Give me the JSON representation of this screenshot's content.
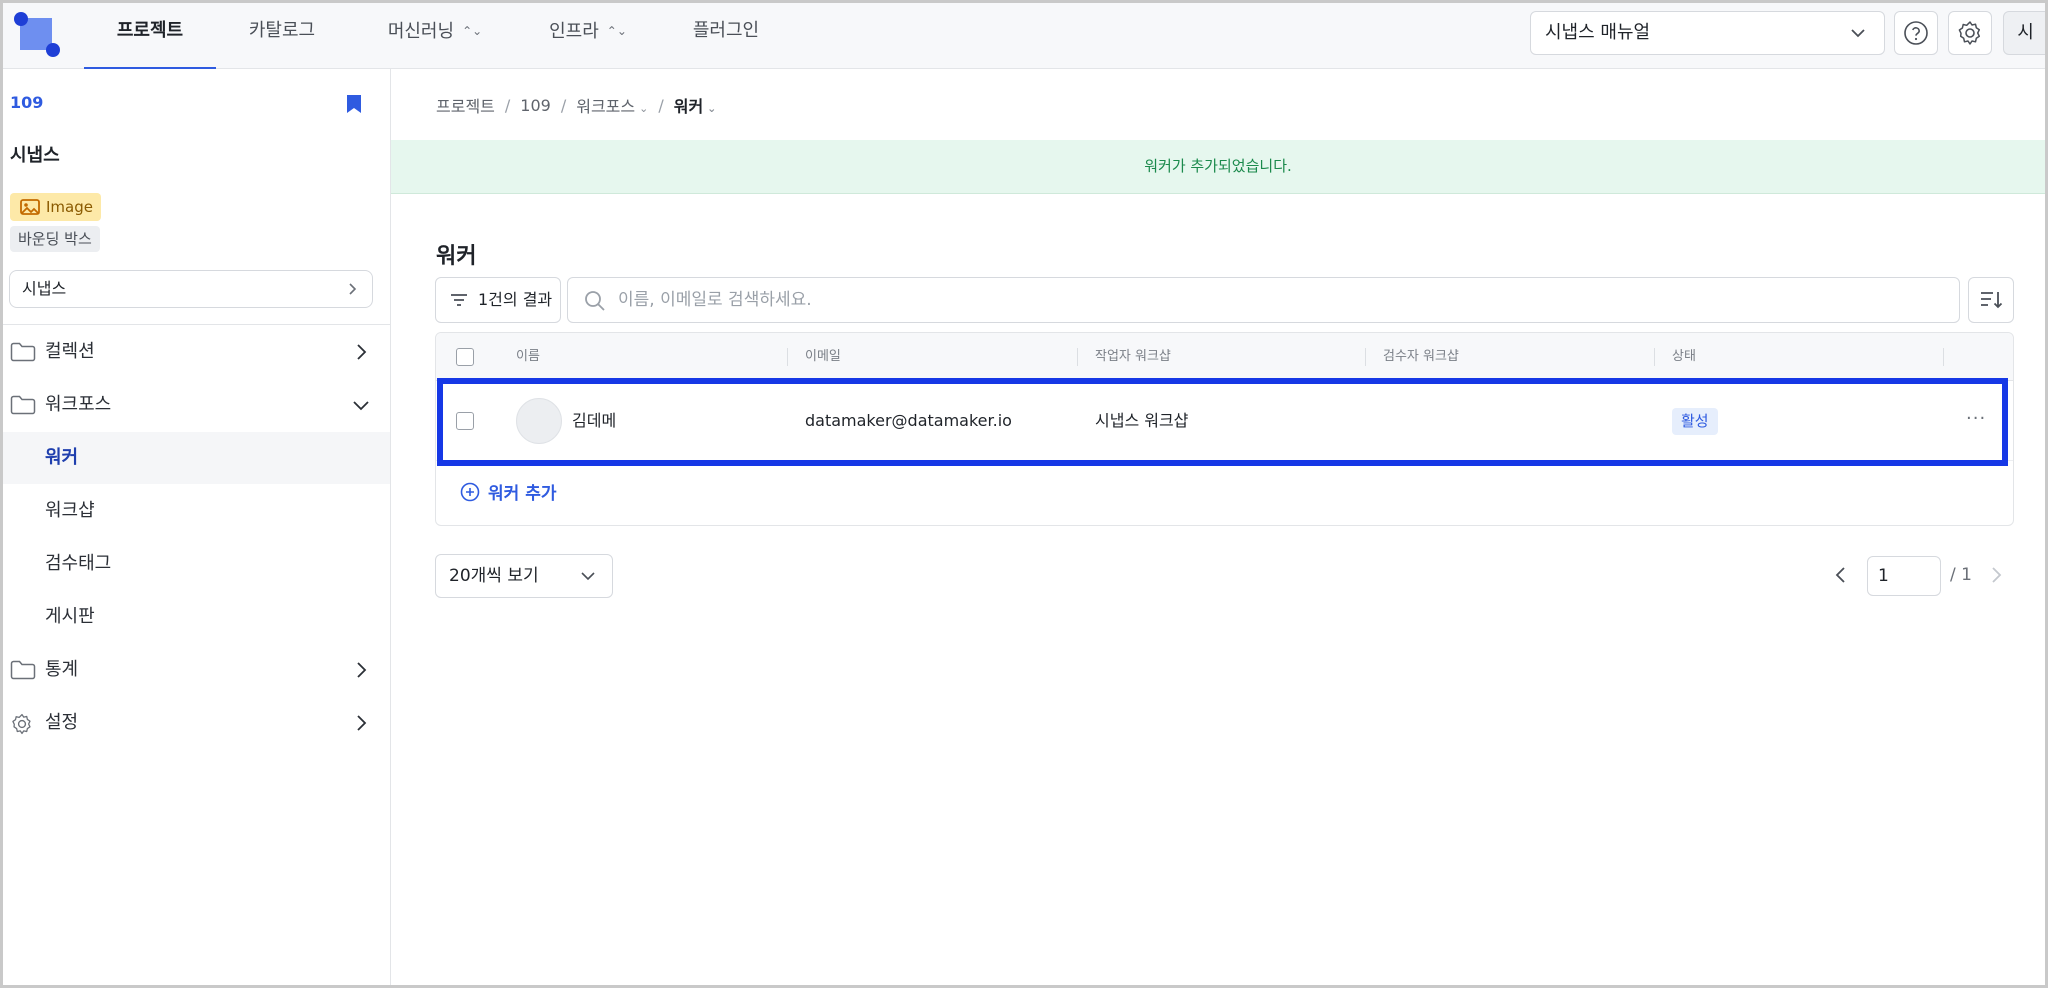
{
  "topnav": {
    "tabs": [
      {
        "label": "프로젝트",
        "active": true
      },
      {
        "label": "카탈로그",
        "active": false
      },
      {
        "label": "머신러닝",
        "active": false,
        "has_caret": true
      },
      {
        "label": "인프라",
        "active": false,
        "has_caret": true
      },
      {
        "label": "플러그인",
        "active": false
      }
    ],
    "manual_select": "시냅스 매뉴얼",
    "user_initial": "시",
    "help_icon": "question-circle-icon",
    "settings_icon": "gear-icon"
  },
  "sidebar": {
    "project_id": "109",
    "project_name": "시냅스",
    "type_badge": "Image",
    "annotation_badge": "바운딩 박스",
    "dataset_select": "시냅스",
    "items": [
      {
        "label": "컬렉션",
        "icon": "folder-icon",
        "expanded": false
      },
      {
        "label": "워크포스",
        "icon": "folder-icon",
        "expanded": true
      }
    ],
    "sub_items": [
      {
        "label": "워커",
        "active": true
      },
      {
        "label": "워크샵",
        "active": false
      },
      {
        "label": "검수태그",
        "active": false
      },
      {
        "label": "게시판",
        "active": false
      }
    ],
    "bottom_items": [
      {
        "label": "통계",
        "icon": "folder-icon"
      },
      {
        "label": "설정",
        "icon": "gear-icon"
      }
    ]
  },
  "breadcrumb": {
    "items": [
      "프로젝트",
      "109",
      "워크포스",
      "워커"
    ]
  },
  "toast": {
    "message": "워커가 추가되었습니다."
  },
  "main": {
    "title": "워커",
    "result_count": "1건의 결과",
    "search_placeholder": "이름, 이메일로 검색하세요.",
    "columns": [
      "이름",
      "이메일",
      "작업자 워크샵",
      "검수자 워크샵",
      "상태"
    ],
    "rows": [
      {
        "name": "김데메",
        "email": "datamaker@datamaker.io",
        "worker_workshop": "시냅스 워크샵",
        "reviewer_workshop": "",
        "status": "활성"
      }
    ],
    "add_worker_label": "워커 추가",
    "page_size": "20개씩 보기",
    "page_current": "1",
    "page_total": "/ 1"
  },
  "colors": {
    "accent": "#2f5be0",
    "highlight_border": "#1638e6",
    "toast_bg": "#e6f7ee",
    "toast_text": "#1b8a4c",
    "image_badge_bg": "#fde9a8"
  }
}
